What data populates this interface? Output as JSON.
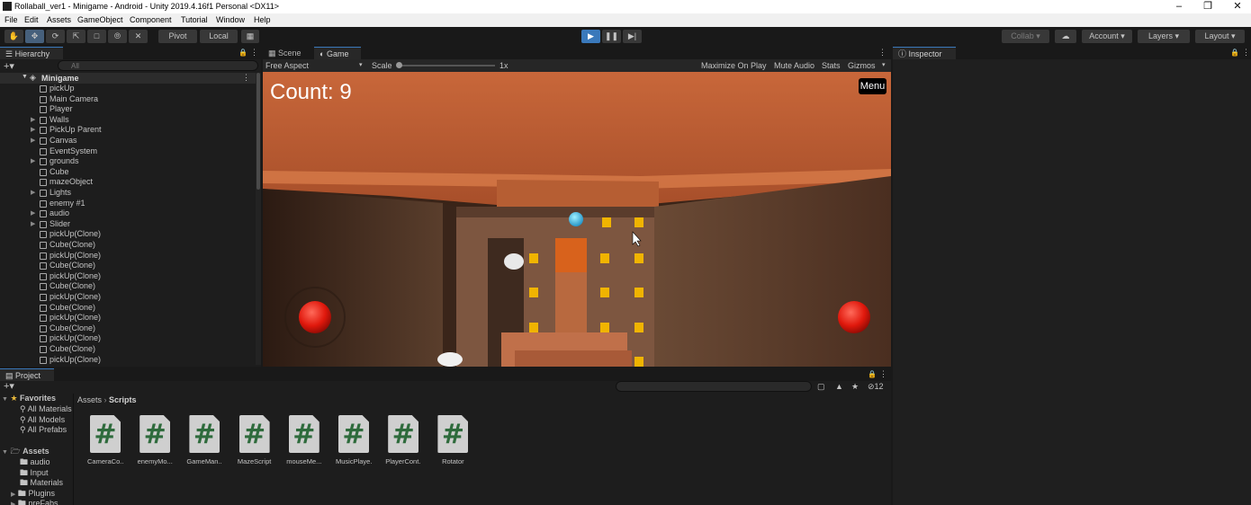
{
  "window": {
    "title": "Rollaball_ver1 - Minigame - Android - Unity 2019.4.16f1 Personal <DX11>"
  },
  "menu": [
    "File",
    "Edit",
    "Assets",
    "GameObject",
    "Component",
    "Tutorial",
    "Window",
    "Help"
  ],
  "toolbar": {
    "pivot_label": "Pivot",
    "local_label": "Local",
    "collab_label": "Collab",
    "account_label": "Account",
    "layers_label": "Layers",
    "layout_label": "Layout"
  },
  "hierarchy": {
    "tab_label": "Hierarchy",
    "search_placeholder": "All",
    "scene_name": "Minigame",
    "items": [
      {
        "label": "pickUp",
        "arrow": false
      },
      {
        "label": "Main Camera",
        "arrow": false
      },
      {
        "label": "Player",
        "arrow": false
      },
      {
        "label": "Walls",
        "arrow": true
      },
      {
        "label": "PickUp Parent",
        "arrow": true
      },
      {
        "label": "Canvas",
        "arrow": true
      },
      {
        "label": "EventSystem",
        "arrow": false
      },
      {
        "label": "grounds",
        "arrow": true
      },
      {
        "label": "Cube",
        "arrow": false
      },
      {
        "label": "mazeObject",
        "arrow": false
      },
      {
        "label": "Lights",
        "arrow": true
      },
      {
        "label": "enemy #1",
        "arrow": false
      },
      {
        "label": "audio",
        "arrow": true
      },
      {
        "label": "Slider",
        "arrow": true
      },
      {
        "label": "pickUp(Clone)",
        "arrow": false
      },
      {
        "label": "Cube(Clone)",
        "arrow": false
      },
      {
        "label": "pickUp(Clone)",
        "arrow": false
      },
      {
        "label": "Cube(Clone)",
        "arrow": false
      },
      {
        "label": "pickUp(Clone)",
        "arrow": false
      },
      {
        "label": "Cube(Clone)",
        "arrow": false
      },
      {
        "label": "pickUp(Clone)",
        "arrow": false
      },
      {
        "label": "Cube(Clone)",
        "arrow": false
      },
      {
        "label": "pickUp(Clone)",
        "arrow": false
      },
      {
        "label": "Cube(Clone)",
        "arrow": false
      },
      {
        "label": "pickUp(Clone)",
        "arrow": false
      },
      {
        "label": "Cube(Clone)",
        "arrow": false
      },
      {
        "label": "pickUp(Clone)",
        "arrow": false
      }
    ]
  },
  "game": {
    "scene_tab": "Scene",
    "game_tab": "Game",
    "aspect": "Free Aspect",
    "scale_label": "Scale",
    "scale_value": "1x",
    "maximize_label": "Maximize On Play",
    "mute_label": "Mute Audio",
    "stats_label": "Stats",
    "gizmos_label": "Gizmos",
    "count_text": "Count: 9",
    "menu_button": "Menu"
  },
  "inspector": {
    "tab_label": "Inspector"
  },
  "project": {
    "tab_label": "Project",
    "breadcrumb_root": "Assets",
    "breadcrumb_leaf": "Scripts",
    "hidden_count": "12",
    "favorites_label": "Favorites",
    "favorites": [
      "All Materials",
      "All Models",
      "All Prefabs"
    ],
    "assets_label": "Assets",
    "folders": [
      "audio",
      "Input",
      "Materials",
      "Plugins",
      "preFabs"
    ],
    "scripts": [
      "CameraCo...",
      "enemyMo...",
      "GameMan...",
      "MazeScript",
      "mouseMe...",
      "MusicPlaye...",
      "PlayerCont...",
      "Rotator"
    ]
  },
  "colors": {
    "accent": "#3a79bb",
    "panel_bg": "#1d1d1d",
    "script_icon": "#2e6b3c"
  }
}
